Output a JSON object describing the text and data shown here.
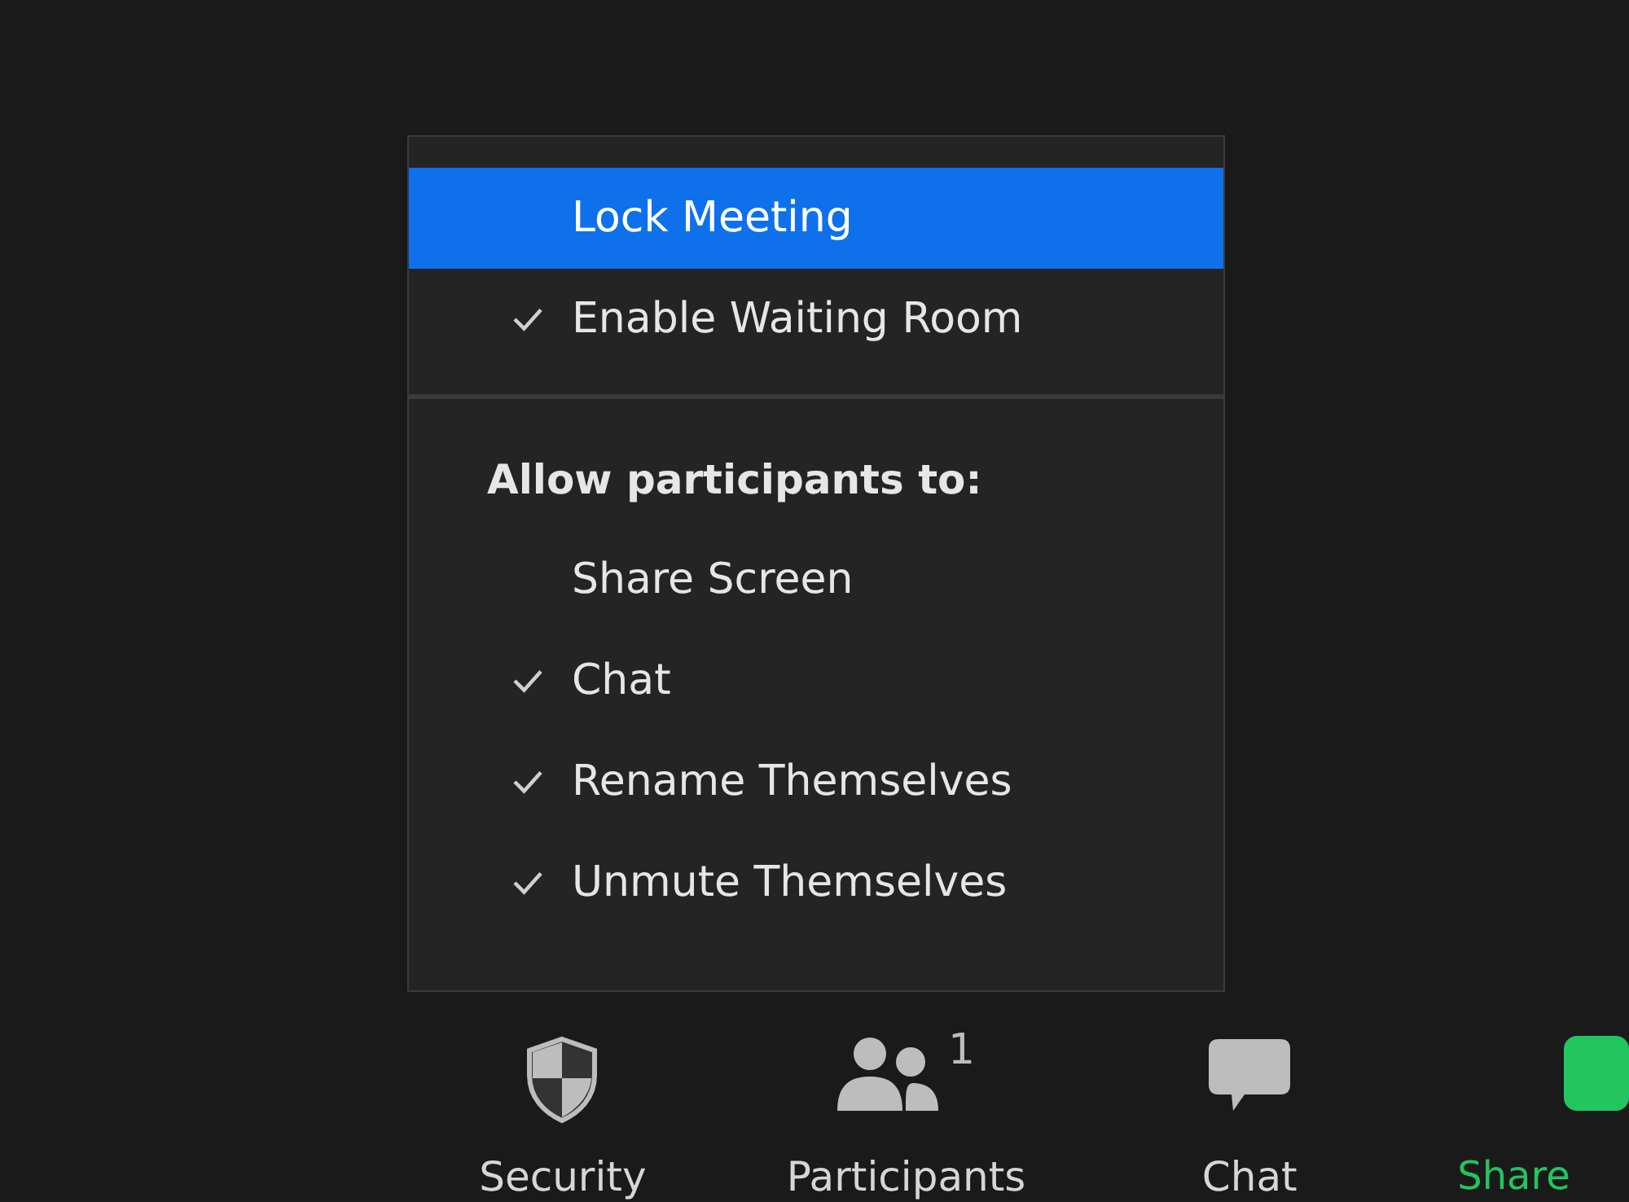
{
  "menu": {
    "sections": [
      {
        "items": [
          {
            "kind": "item",
            "label": "Lock Meeting",
            "checked": false,
            "selected": true
          },
          {
            "kind": "item",
            "label": "Enable Waiting Room",
            "checked": true,
            "selected": false
          }
        ]
      },
      {
        "items": [
          {
            "kind": "header",
            "label": "Allow participants to:"
          },
          {
            "kind": "item",
            "label": "Share Screen",
            "checked": false,
            "selected": false
          },
          {
            "kind": "item",
            "label": "Chat",
            "checked": true,
            "selected": false
          },
          {
            "kind": "item",
            "label": "Rename Themselves",
            "checked": true,
            "selected": false
          },
          {
            "kind": "item",
            "label": "Unmute Themselves",
            "checked": true,
            "selected": false
          }
        ]
      }
    ]
  },
  "toolbar": [
    {
      "kind": "security",
      "label": "Security"
    },
    {
      "kind": "participants",
      "label": "Participants",
      "count": "1"
    },
    {
      "kind": "chat",
      "label": "Chat"
    },
    {
      "kind": "share",
      "label": "Share"
    }
  ]
}
